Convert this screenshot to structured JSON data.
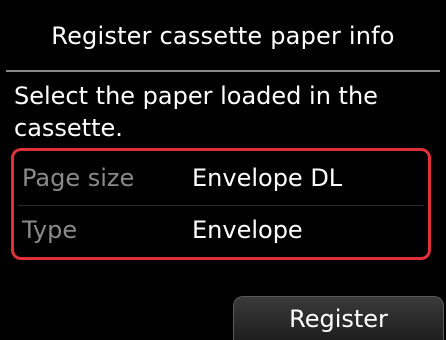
{
  "header": {
    "title": "Register cassette paper info"
  },
  "main": {
    "instruction": "Select the paper loaded in the cassette.",
    "settings": [
      {
        "label": "Page size",
        "value": "Envelope DL"
      },
      {
        "label": "Type",
        "value": "Envelope"
      }
    ]
  },
  "footer": {
    "register_label": "Register"
  },
  "colors": {
    "background": "#000000",
    "highlight_border": "#e0313a",
    "label_text": "#8a8a8a",
    "value_text": "#ffffff"
  }
}
